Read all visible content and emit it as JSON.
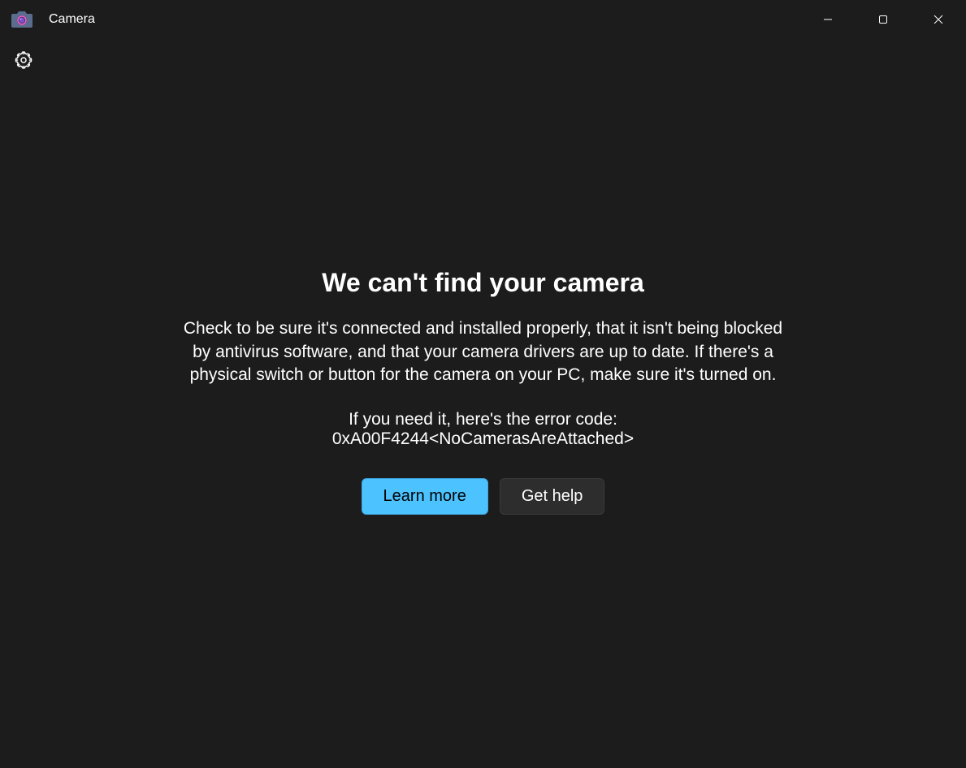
{
  "titlebar": {
    "app_name": "Camera"
  },
  "error": {
    "heading": "We can't find your camera",
    "description": "Check to be sure it's connected and installed properly, that it isn't being blocked by antivirus software, and that your camera drivers are up to date. If there's a physical switch or button for the camera on your PC, make sure it's turned on.",
    "code_intro": "If you need it, here's the error code:",
    "code": "0xA00F4244<NoCamerasAreAttached>"
  },
  "buttons": {
    "learn_more": "Learn more",
    "get_help": "Get help"
  }
}
